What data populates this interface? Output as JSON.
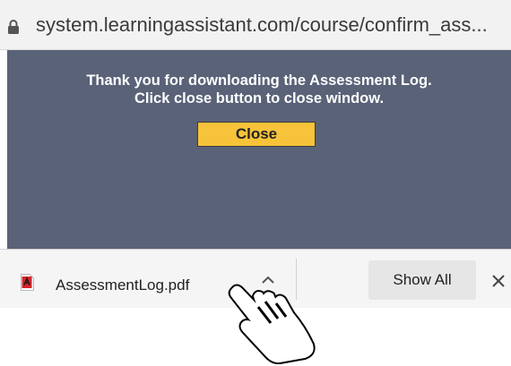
{
  "address_bar": {
    "url": "system.learningassistant.com/course/confirm_ass...",
    "lock_icon": "lock-icon"
  },
  "page": {
    "message_line1": "Thank you for downloading the Assessment Log.",
    "message_line2": "Click close button to close window.",
    "close_button_label": "Close",
    "background_color": "#5a6278",
    "button_color": "#f7c33a"
  },
  "download_shelf": {
    "file_icon": "pdf-icon",
    "file_name": "AssessmentLog.pdf",
    "expand_icon": "chevron-up-icon",
    "show_all_label": "Show All",
    "close_icon": "close-icon"
  },
  "cursor": {
    "icon": "hand-pointer-icon"
  }
}
